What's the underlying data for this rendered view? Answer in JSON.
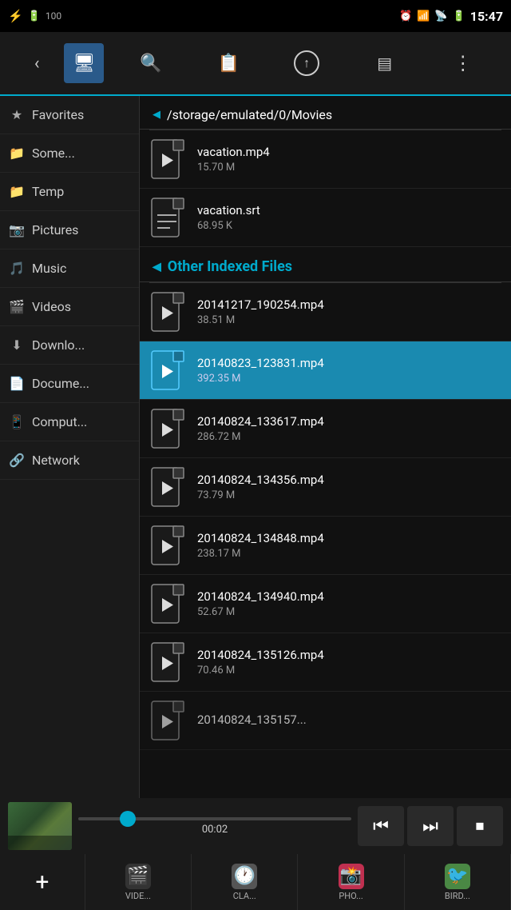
{
  "status": {
    "time": "15:47",
    "left_icons": [
      "usb-icon",
      "battery-icon"
    ]
  },
  "toolbar": {
    "back_label": "‹",
    "device_icon": "🖥",
    "search_label": "🔍",
    "clipboard_label": "📋",
    "upload_label": "⬆",
    "list_label": "≡",
    "more_label": "⋮"
  },
  "sidebar": {
    "items": [
      {
        "id": "favorites",
        "icon": "★",
        "label": "Favorites"
      },
      {
        "id": "some",
        "icon": "📁",
        "label": "Some..."
      },
      {
        "id": "temp",
        "icon": "📁",
        "label": "Temp"
      },
      {
        "id": "pictures",
        "icon": "📷",
        "label": "Pictures"
      },
      {
        "id": "music",
        "icon": "🎵",
        "label": "Music"
      },
      {
        "id": "videos",
        "icon": "🎬",
        "label": "Videos"
      },
      {
        "id": "downloads",
        "icon": "⬇",
        "label": "Downlo..."
      },
      {
        "id": "documents",
        "icon": "📄",
        "label": "Docume..."
      },
      {
        "id": "computer",
        "icon": "📱",
        "label": "Comput..."
      },
      {
        "id": "network",
        "icon": "🔗",
        "label": "Network"
      }
    ]
  },
  "main": {
    "path": {
      "prefix": "▸",
      "text": "/storage/emulated/0/Movies"
    },
    "movies_files": [
      {
        "name": "vacation.mp4",
        "size": "15.70 M",
        "type": "video"
      },
      {
        "name": "vacation.srt",
        "size": "68.95 K",
        "type": "doc"
      }
    ],
    "indexed_section": "Other Indexed Files",
    "indexed_files": [
      {
        "name": "20141217_190254.mp4",
        "size": "38.51 M",
        "type": "video",
        "selected": false
      },
      {
        "name": "20140823_123831.mp4",
        "size": "392.35 M",
        "type": "video",
        "selected": true
      },
      {
        "name": "20140824_133617.mp4",
        "size": "286.72 M",
        "type": "video",
        "selected": false
      },
      {
        "name": "20140824_134356.mp4",
        "size": "73.79 M",
        "type": "video",
        "selected": false
      },
      {
        "name": "20140824_134848.mp4",
        "size": "238.17 M",
        "type": "video",
        "selected": false
      },
      {
        "name": "20140824_134940.mp4",
        "size": "52.67 M",
        "type": "video",
        "selected": false
      },
      {
        "name": "20140824_135126.mp4",
        "size": "70.46 M",
        "type": "video",
        "selected": false
      },
      {
        "name": "20140824_135157...",
        "size": "",
        "type": "video",
        "selected": false
      }
    ]
  },
  "player": {
    "time": "00:02",
    "prev_label": "⏮",
    "next_label": "⏭",
    "stop_label": "⏹"
  },
  "appbar": {
    "add_label": "+",
    "items": [
      {
        "id": "video",
        "icon_color": "#555",
        "icon_char": "🎬",
        "label": "VIDE..."
      },
      {
        "id": "clock",
        "icon_color": "#888",
        "icon_char": "🕐",
        "label": "CLA..."
      },
      {
        "id": "camera",
        "icon_color": "#c05",
        "icon_char": "📸",
        "label": "PHO..."
      },
      {
        "id": "bird",
        "icon_color": "#4a8",
        "icon_char": "🐦",
        "label": "BIRD..."
      }
    ]
  }
}
